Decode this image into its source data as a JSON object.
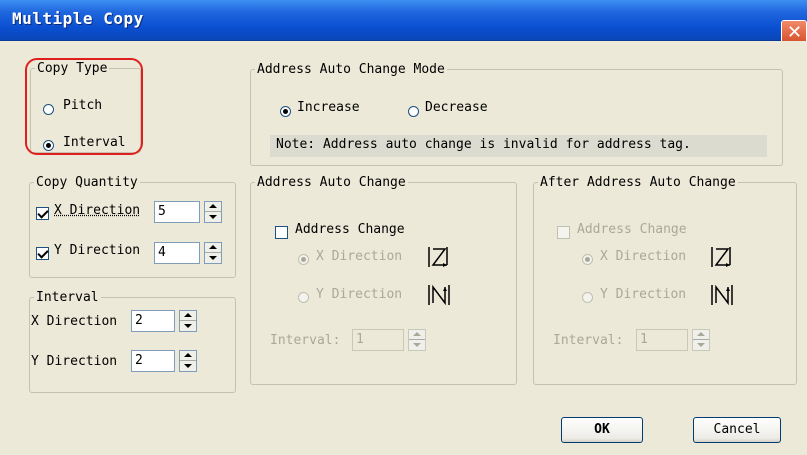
{
  "window": {
    "title": "Multiple Copy"
  },
  "copy_type": {
    "legend": "Copy Type",
    "options": [
      {
        "label": "Pitch",
        "selected": false
      },
      {
        "label": "Interval",
        "selected": true
      }
    ]
  },
  "address_mode": {
    "legend": "Address Auto Change Mode",
    "options": [
      {
        "label": "Increase",
        "selected": true
      },
      {
        "label": "Decrease",
        "selected": false
      }
    ],
    "note": "Note: Address auto change is invalid for address tag."
  },
  "copy_quantity": {
    "legend": "Copy Quantity",
    "x": {
      "label": "X Direction",
      "checked": true,
      "value": "5"
    },
    "y": {
      "label": "Y Direction",
      "checked": true,
      "value": "4"
    }
  },
  "interval": {
    "legend": "Interval",
    "x": {
      "label": "X Direction",
      "value": "2"
    },
    "y": {
      "label": "Y Direction",
      "value": "2"
    }
  },
  "address_change": {
    "legend": "Address Auto Change",
    "checkbox_label": "Address Change",
    "x_label": "X Direction",
    "y_label": "Y Direction",
    "interval_label": "Interval:",
    "interval_value": "1"
  },
  "after_change": {
    "legend": "After Address Auto Change",
    "checkbox_label": "Address Change",
    "x_label": "X Direction",
    "y_label": "Y Direction",
    "interval_label": "Interval:",
    "interval_value": "1"
  },
  "buttons": {
    "ok": "OK",
    "cancel": "Cancel"
  },
  "colors": {
    "title_bar": "#0a4fd0",
    "highlight": "#e0201e",
    "dialog_bg": "#ece9d8"
  }
}
